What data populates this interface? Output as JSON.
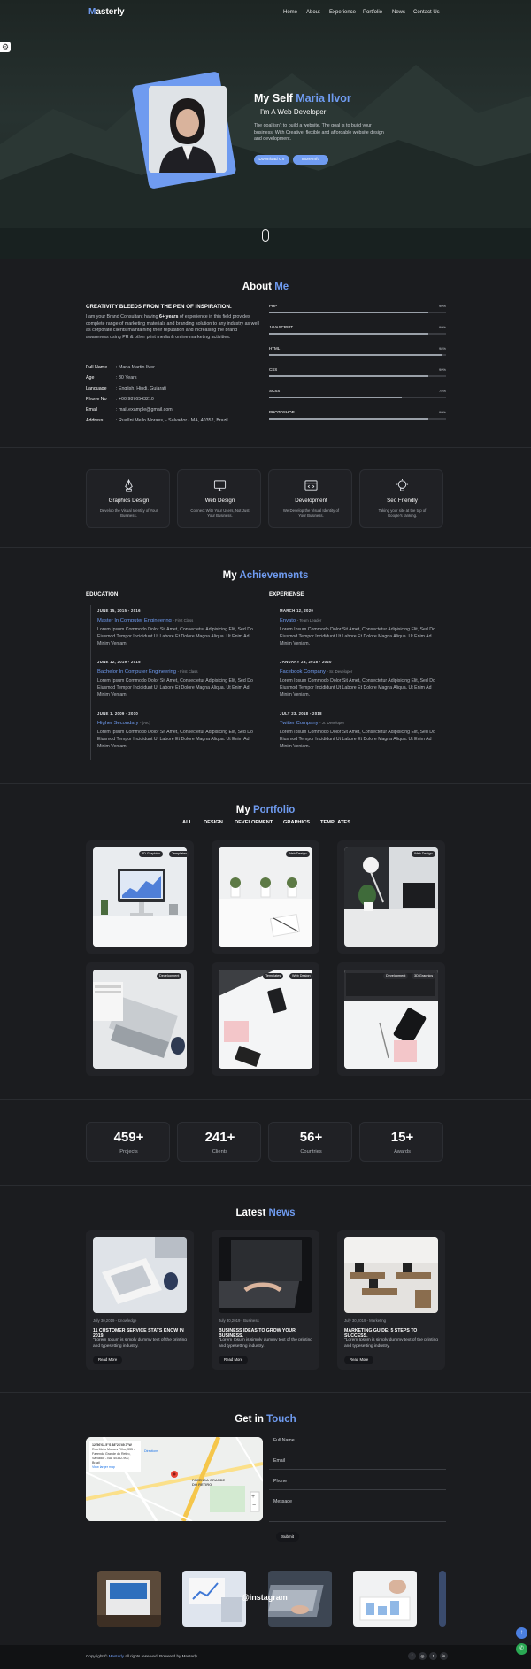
{
  "brand": {
    "logo_first": "M",
    "logo_rest": "asterly",
    "accent": "#6f9bf0"
  },
  "nav": {
    "items": [
      "Home",
      "About",
      "Experience",
      "Portfolio",
      "News",
      "Contact Us"
    ]
  },
  "hero": {
    "title_prefix": "My Self",
    "title_name": "Maria Ilvor",
    "subtitle": "I'm A Web Developer",
    "description": "The goal isn't to build a website. The goal is to build your business. With Creative, flexible and affordable website design and development.",
    "btn_cv": "Download CV",
    "btn_info": "More Info"
  },
  "about": {
    "title_a": "About",
    "title_b": "Me",
    "heading": "CREATIVITY BLEEDS FROM THE PEN OF INSPIRATION.",
    "text_a": "I am your Brand Consultant having",
    "text_bold": "6+ years",
    "text_b": "of experience in this field provides complete range of marketing materials and branding solution to any industry as well as corporate clients maintaining their reputation and increasing the brand awareness using PR & other print media & online marketing activities.",
    "info": [
      {
        "k": "Full Name",
        "v": "Maria Martin Ilvor"
      },
      {
        "k": "Age",
        "v": "30 Years"
      },
      {
        "k": "Language",
        "v": "English, Hindi, Gujarati"
      },
      {
        "k": "Phone No",
        "v": "+00 9876543210"
      },
      {
        "k": "Email",
        "v": "mail.example@gmail.com"
      },
      {
        "k": "Address",
        "v": "Rua/Ini Mello Moraes, - Salvador - MA, 40352, Brazil."
      }
    ],
    "skills": [
      {
        "name": "PHP",
        "percent": "90%",
        "value": 90
      },
      {
        "name": "JAVASCRIPT",
        "percent": "90%",
        "value": 90
      },
      {
        "name": "HTML",
        "percent": "98%",
        "value": 98
      },
      {
        "name": "CSS",
        "percent": "90%",
        "value": 90
      },
      {
        "name": "SCSS",
        "percent": "75%",
        "value": 75
      },
      {
        "name": "PHOTOSHOP",
        "percent": "90%",
        "value": 90
      }
    ]
  },
  "services": [
    {
      "title": "Graphics Design",
      "desc": "Develop the Visual Identity of Your Business.",
      "icon": "pen-tool-icon"
    },
    {
      "title": "Web Design",
      "desc": "Connect With Your Users, Not Just Your Business.",
      "icon": "monitor-icon"
    },
    {
      "title": "Development",
      "desc": "We Develop the Visual Identity of Your Business.",
      "icon": "browser-code-icon"
    },
    {
      "title": "Seo Friendly",
      "desc": "Taking your site at the top of Google's ranking.",
      "icon": "bulb-icon"
    }
  ],
  "achievements": {
    "title_a": "My",
    "title_b": "Achievements",
    "education_label": "EDUCATION",
    "experience_label": "EXPERIENSE",
    "education": [
      {
        "date": "JUNE 15, 2015 - 2016",
        "title": "Master In Computer Engineering",
        "note": "- First Class",
        "text": "Lorem Ipsum Commodo Dolor Sit Amet, Consectetur Adipisicing Elit, Sed Do Eiusmod Tempor Incididunt Ut Labore Et Dolore Magna Aliqua. Ut Enim Ad Minim Veniam."
      },
      {
        "date": "JUNE 12, 2019 - 2015",
        "title": "Bachelor In Computer Engineering",
        "note": "- First Class",
        "text": "Lorem Ipsum Commodo Dolor Sit Amet, Consectetur Adipisicing Elit, Sed Do Eiusmod Tempor Incididunt Ut Labore Et Dolore Magna Aliqua. Ut Enim Ad Minim Veniam."
      },
      {
        "date": "JUNE 1, 2009 - 2010",
        "title": "Higher Secondary",
        "note": "- (Arc)",
        "text": "Lorem Ipsum Commodo Dolor Sit Amet, Consectetur Adipisicing Elit, Sed Do Eiusmod Tempor Incididunt Ut Labore Et Dolore Magna Aliqua. Ut Enim Ad Minim Veniam."
      }
    ],
    "experience": [
      {
        "date": "MARCH 12, 2020",
        "title": "Envato",
        "note": "- Team Leader",
        "text": "Lorem Ipsum Commodo Dolor Sit Amet, Consectetur Adipisicing Elit, Sed Do Eiusmod Tempor Incididunt Ut Labore Et Dolore Magna Aliqua. Ut Enim Ad Minim Veniam."
      },
      {
        "date": "JANUARY 25, 2018 - 2020",
        "title": "Facebook Company",
        "note": "- Sr. Developer",
        "text": "Lorem Ipsum Commodo Dolor Sit Amet, Consectetur Adipisicing Elit, Sed Do Eiusmod Tempor Incididunt Ut Labore Et Dolore Magna Aliqua. Ut Enim Ad Minim Veniam."
      },
      {
        "date": "JULY 23, 2018 - 2018",
        "title": "Twitter Company",
        "note": "- Jr. Developer",
        "text": "Lorem Ipsum Commodo Dolor Sit Amet, Consectetur Adipisicing Elit, Sed Do Eiusmod Tempor Incididunt Ut Labore Et Dolore Magna Aliqua. Ut Enim Ad Minim Veniam."
      }
    ]
  },
  "portfolio": {
    "title_a": "My",
    "title_b": "Portfolio",
    "tabs": [
      "ALL",
      "DESIGN",
      "DEVELOPMENT",
      "GRAPHICS",
      "TEMPLATES"
    ],
    "items": [
      {
        "tags": [
          "3D Graphics",
          "Templates"
        ]
      },
      {
        "tags": [
          "Web Design"
        ]
      },
      {
        "tags": [
          "Web Design"
        ]
      },
      {
        "tags": [
          "Development"
        ]
      },
      {
        "tags": [
          "Templates",
          "Web Design"
        ]
      },
      {
        "tags": [
          "Development",
          "3D Graphics"
        ]
      }
    ]
  },
  "stats": [
    {
      "value": "459+",
      "label": "Projects"
    },
    {
      "value": "241+",
      "label": "Clients"
    },
    {
      "value": "56+",
      "label": "Countries"
    },
    {
      "value": "15+",
      "label": "Awards"
    }
  ],
  "news": {
    "title_a": "Latest",
    "title_b": "News",
    "read_more": "Read More",
    "items": [
      {
        "meta": "July 30,2019 - Knowledge",
        "title": "11 CUSTOMER SERVICE STATS KNOW IN 2019.",
        "text": "\"Lorem Ipsum is simply dummy text of the printing and typesetting industry."
      },
      {
        "meta": "July 30,2019 - Business",
        "title": "BUSINESS IDEAS TO GROW YOUR BUSINESS.",
        "text": "\"Lorem Ipsum is simply dummy text of the printing and typesetting industry."
      },
      {
        "meta": "July 30,2019 - Marketing",
        "title": "MARKETING GUIDE: 5 STEPS TO SUCCESS.",
        "text": "\"Lorem Ipsum is simply dummy text of the printing and typesetting industry."
      }
    ]
  },
  "contact": {
    "title_a": "Get in",
    "title_b": "Touch",
    "map_coords": "12°56'02.5\"S 38°26'49.7\"W",
    "map_address": "Rua Mello Moraes Filho, 335 - Fazenda Grande do Retiro, Salvador - BA, 40352-900, Brazil",
    "map_link": "View larger map",
    "map_directions": "Directions",
    "map_place": "FAZENDA GRANDE DO RETIRO",
    "fields": [
      "Full Name",
      "Email",
      "Phone",
      "Message"
    ],
    "submit": "Submit"
  },
  "instagram": {
    "label": "@instagram"
  },
  "footer": {
    "copy_a": "Copyright ©",
    "copy_brand": "Masterly",
    "copy_b": "all rights reserved. Powered by Masterly",
    "social": [
      "f",
      "◎",
      "t",
      "in"
    ]
  }
}
